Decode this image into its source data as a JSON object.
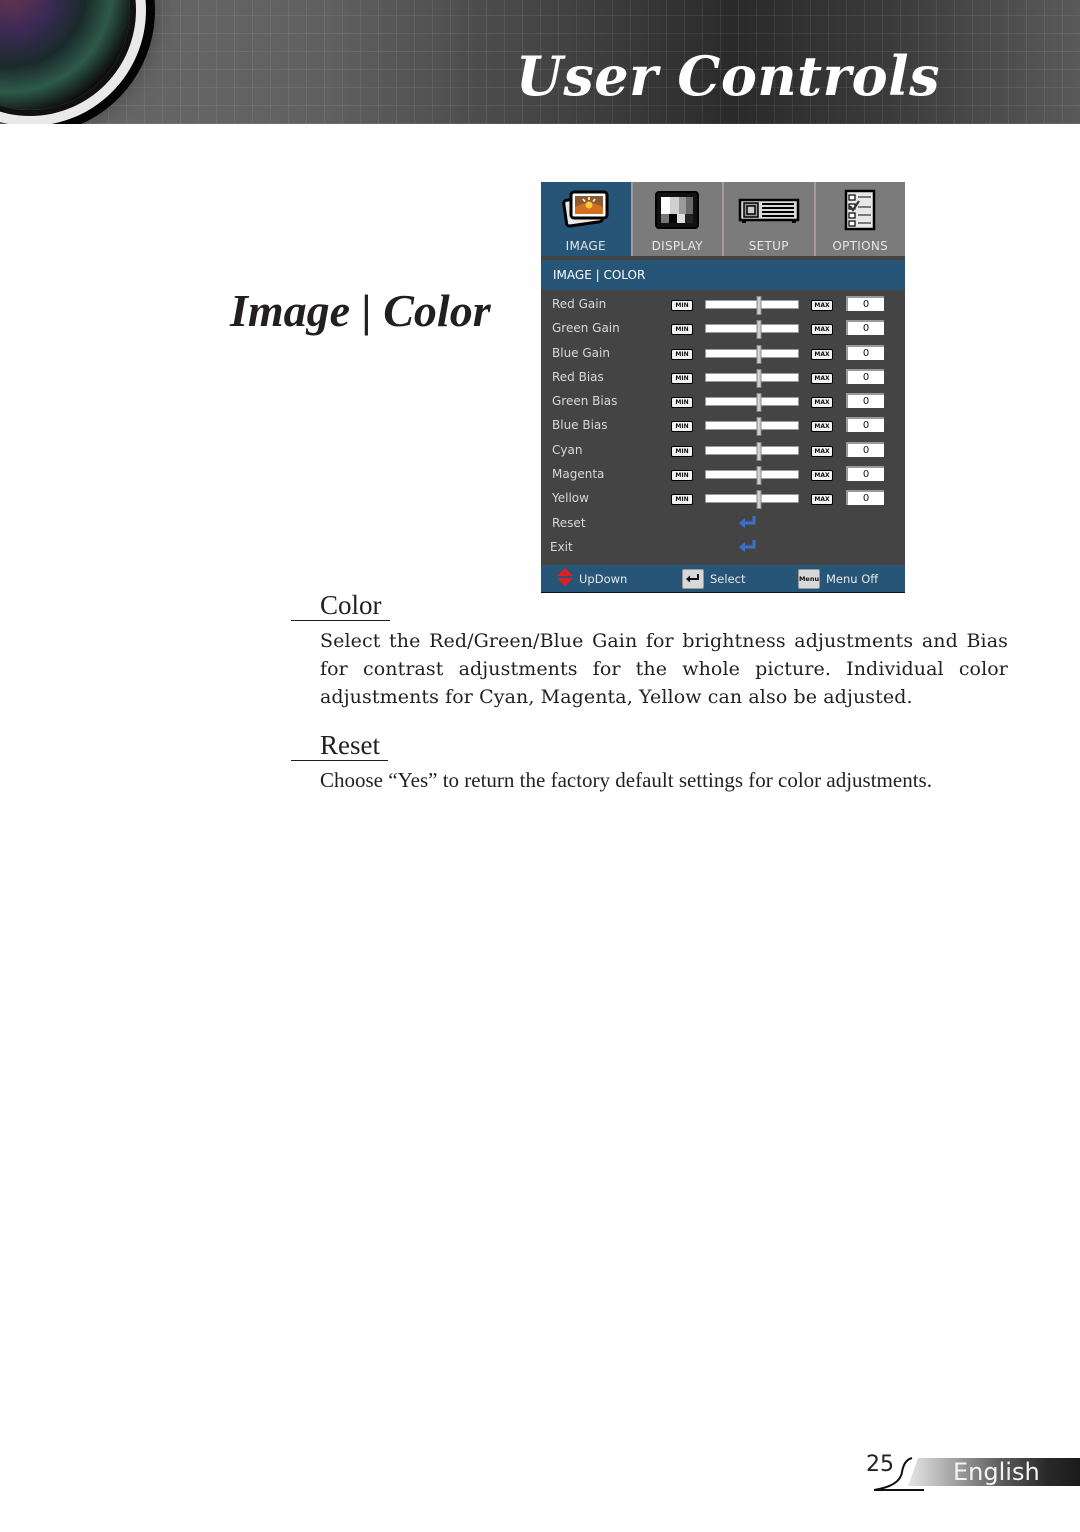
{
  "header": {
    "title": "User Controls"
  },
  "section_title": "Image | Color",
  "osd": {
    "tabs": [
      {
        "label": "IMAGE",
        "icon": "image-icon",
        "active": true
      },
      {
        "label": "DISPLAY",
        "icon": "display-icon",
        "active": false
      },
      {
        "label": "SETUP",
        "icon": "projector-icon",
        "active": false
      },
      {
        "label": "OPTIONS",
        "icon": "checklist-icon",
        "active": false
      }
    ],
    "breadcrumb": "IMAGE | COLOR",
    "min_label": "MIN",
    "max_label": "MAX",
    "rows": [
      {
        "label": "Red Gain",
        "value": "0",
        "slider_fraction": 0.58
      },
      {
        "label": "Green Gain",
        "value": "0",
        "slider_fraction": 0.58
      },
      {
        "label": "Blue Gain",
        "value": "0",
        "slider_fraction": 0.58
      },
      {
        "label": "Red Bias",
        "value": "0",
        "slider_fraction": 0.58
      },
      {
        "label": "Green Bias",
        "value": "0",
        "slider_fraction": 0.58
      },
      {
        "label": "Blue Bias",
        "value": "0",
        "slider_fraction": 0.58
      },
      {
        "label": "Cyan",
        "value": "0",
        "slider_fraction": 0.58
      },
      {
        "label": "Magenta",
        "value": "0",
        "slider_fraction": 0.58
      },
      {
        "label": "Yellow",
        "value": "0",
        "slider_fraction": 0.58
      }
    ],
    "actions": [
      {
        "label": "Reset",
        "icon": "enter-icon"
      },
      {
        "label": "Exit",
        "icon": "enter-icon"
      }
    ],
    "footer": {
      "updown": "UpDown",
      "select": "Select",
      "menu_key": "Menu",
      "menu_off": "Menu Off"
    },
    "colors": {
      "accent_blue": "#275577",
      "panel_gray": "#444444",
      "tab_gray": "#7b7b7b",
      "enter_arrow": "#3a6fd0",
      "updown_red": "#e02020"
    }
  },
  "sections": [
    {
      "heading": "Color",
      "body": "Select the Red/Green/Blue Gain for brightness adjustments and Bias for contrast adjustments for the whole picture. Individual color adjustments for Cyan, Magenta, Yellow can also be adjusted."
    },
    {
      "heading": "Reset",
      "body": "Choose “Yes” to return the factory default settings for color adjustments."
    }
  ],
  "footer": {
    "page_number": "25",
    "language": "English"
  }
}
